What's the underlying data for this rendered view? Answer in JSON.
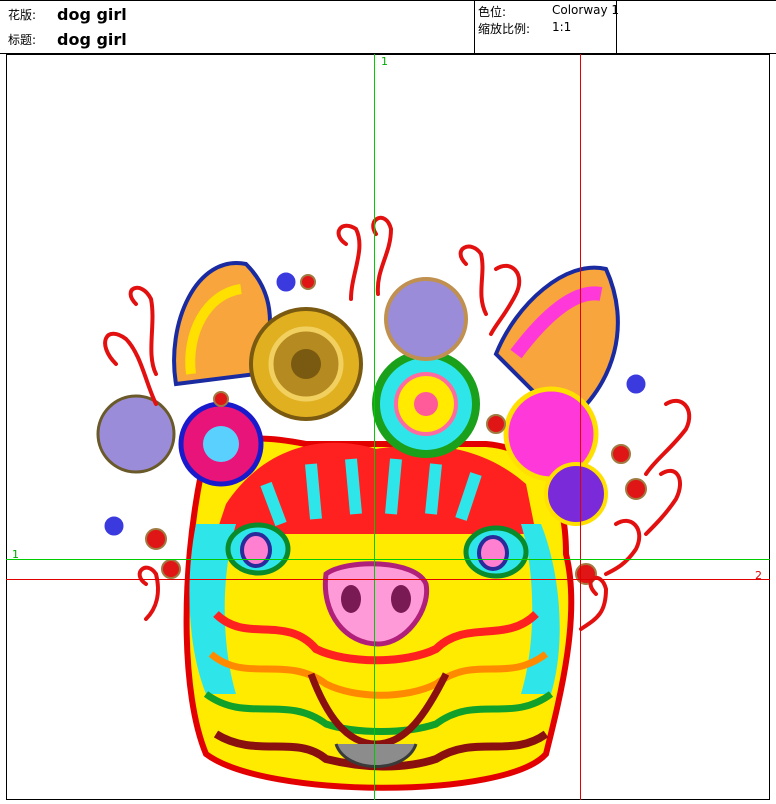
{
  "header": {
    "pattern_label": "花版:",
    "pattern_value": "dog girl",
    "title_label": "标题:",
    "title_value": "dog girl",
    "colorway_label": "色位:",
    "colorway_value": "Colorway 1",
    "scale_label": "缩放比例:",
    "scale_value": "1:1"
  },
  "guides": {
    "top_marker": "1",
    "left_marker": "1",
    "right_marker": "2",
    "green_color": "#00cc00",
    "red_color": "#e00000"
  },
  "artwork": {
    "description_icon": "embroidered-dog-icon"
  }
}
